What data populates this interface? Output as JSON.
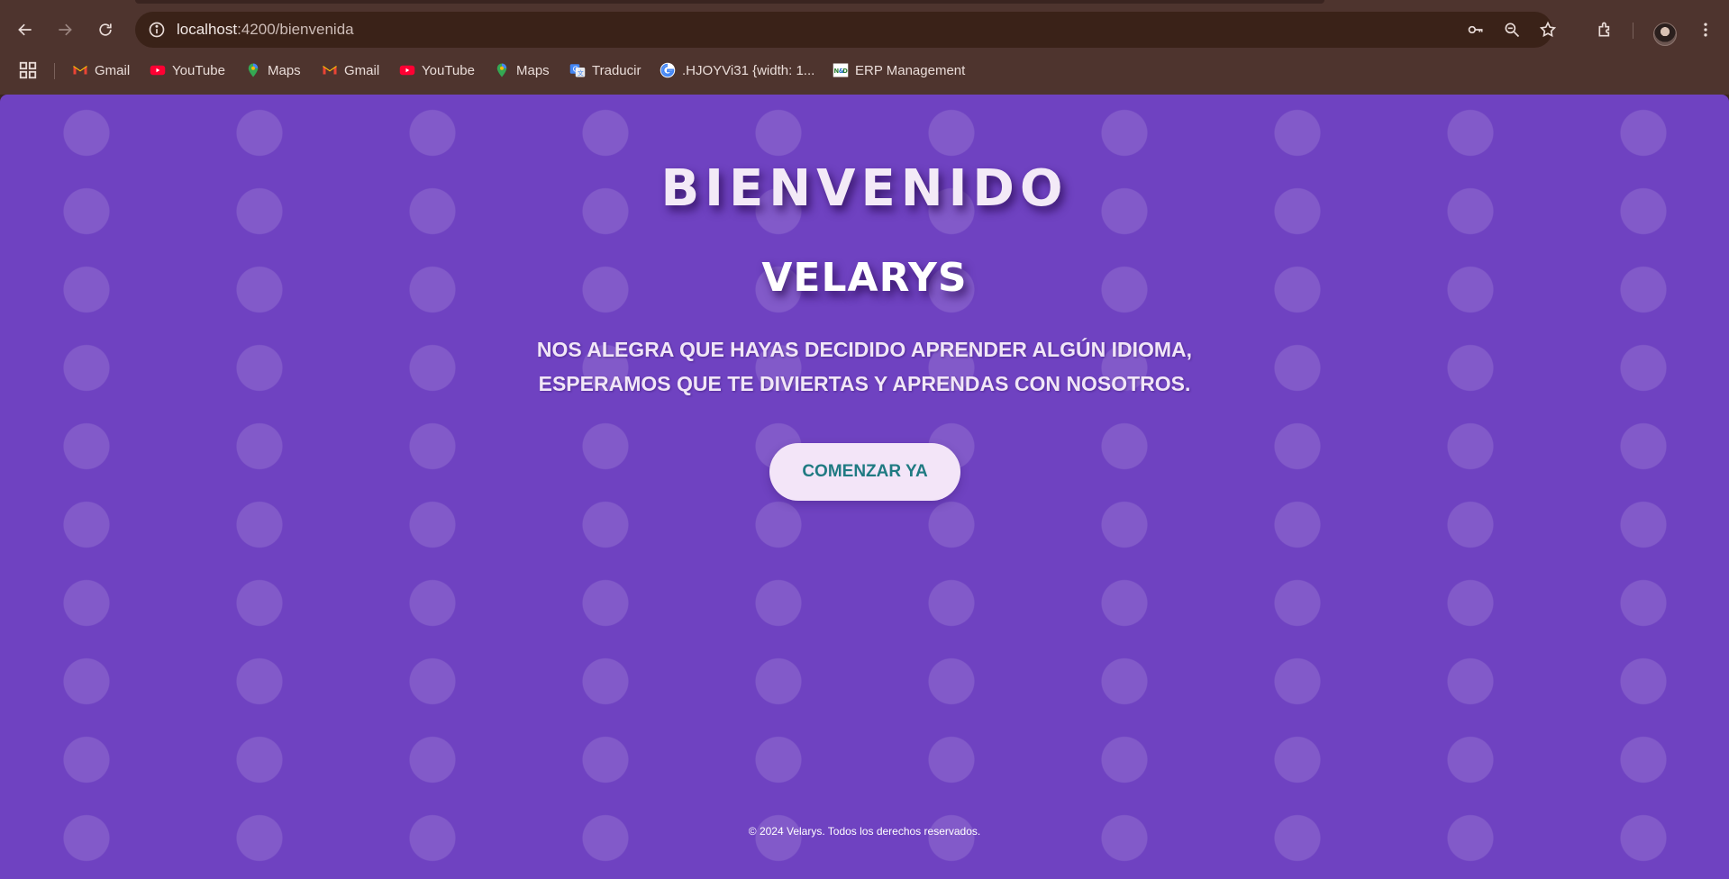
{
  "browser": {
    "url_host": "localhost",
    "url_path": ":4200/bienvenida",
    "bookmarks": [
      {
        "label": "Gmail",
        "icon": "gmail-icon"
      },
      {
        "label": "YouTube",
        "icon": "youtube-icon"
      },
      {
        "label": "Maps",
        "icon": "maps-icon"
      },
      {
        "label": "Gmail",
        "icon": "gmail-icon"
      },
      {
        "label": "YouTube",
        "icon": "youtube-icon"
      },
      {
        "label": "Maps",
        "icon": "maps-icon"
      },
      {
        "label": "Traducir",
        "icon": "translate-icon"
      },
      {
        "label": ".HJOYVi31 {width: 1...",
        "icon": "google-icon"
      },
      {
        "label": "ERP Management",
        "icon": "erp-icon"
      }
    ]
  },
  "page": {
    "title": "BIENVENIDO",
    "brand": "VELARYS",
    "tagline_line1": "NOS ALEGRA QUE HAYAS DECIDIDO APRENDER ALGÚN IDIOMA,",
    "tagline_line2": "ESPERAMOS QUE TE DIVIERTAS Y APRENDAS CON NOSOTROS.",
    "cta_label": "COMENZAR YA",
    "footer": "© 2024 Velarys. Todos los derechos reservados."
  },
  "colors": {
    "page_background": "#6f42c1",
    "button_background": "#f3e5f8",
    "button_text": "#1f7a82",
    "chrome_background": "#4e342e"
  }
}
